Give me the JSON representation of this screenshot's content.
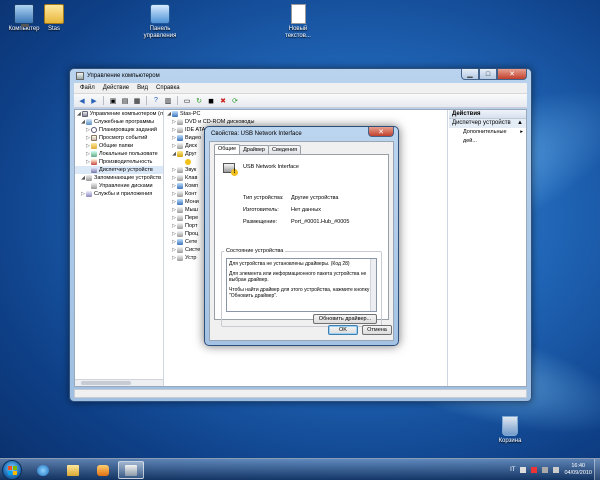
{
  "desktop": {
    "icons": [
      {
        "label": "Компьютер"
      },
      {
        "label": "Stas"
      },
      {
        "label": "Панель управления"
      },
      {
        "label": "Новый текстов..."
      },
      {
        "label": "Корзина"
      }
    ]
  },
  "window": {
    "title": "Управление компьютером",
    "menu": [
      "Файл",
      "Действие",
      "Вид",
      "Справка"
    ],
    "tree": [
      {
        "label": "Управление компьютером (л",
        "level": 0
      },
      {
        "label": "Служебные программы",
        "level": 1
      },
      {
        "label": "Планировщик заданий",
        "level": 2
      },
      {
        "label": "Просмотр событий",
        "level": 2
      },
      {
        "label": "Общие папки",
        "level": 2
      },
      {
        "label": "Локальные пользовате",
        "level": 2
      },
      {
        "label": "Производительность",
        "level": 2
      },
      {
        "label": "Диспетчер устройств",
        "level": 2
      },
      {
        "label": "Запоминающие устройств",
        "level": 1
      },
      {
        "label": "Управление дисками",
        "level": 2
      },
      {
        "label": "Службы и приложения",
        "level": 1
      }
    ],
    "devices": [
      "Stas-PC",
      "DVD и CD-ROM дисководы",
      "IDE ATA/ATAPI контроллеры",
      "Видео",
      "Диск",
      "Друг",
      "Звук",
      "Клав",
      "Комп",
      "Конт",
      "Мони",
      "Мыш",
      "Пере",
      "Порт",
      "Проц",
      "Сете",
      "Систе",
      "Устр"
    ],
    "actions": {
      "header": "Действия",
      "section": "Диспетчер устройств",
      "more": "Дополнительные дей..."
    }
  },
  "dialog": {
    "title": "Свойства: USB Network Interface",
    "tabs": [
      "Общие",
      "Драйвер",
      "Сведения"
    ],
    "device_name": "USB Network Interface",
    "props": [
      {
        "label": "Тип устройства:",
        "value": "Другие устройства"
      },
      {
        "label": "Изготовитель:",
        "value": "Нет данных"
      },
      {
        "label": "Размещение:",
        "value": "Port_#0001.Hub_#0005"
      }
    ],
    "status_title": "Состояние устройства",
    "status_lines": [
      "Для устройства не установлены драйверы. (Код 28)",
      "Для элемента или информационного пакета устройства не выбран драйвер.",
      "Чтобы найти драйвер для этого устройства, нажмите кнопку \"Обновить драйвер\"."
    ],
    "update_button": "Обновить драйвер...",
    "ok": "OK",
    "cancel": "Отмена"
  },
  "taskbar": {
    "lang": "IT",
    "time": "16:40",
    "date": "04/09/2010"
  }
}
